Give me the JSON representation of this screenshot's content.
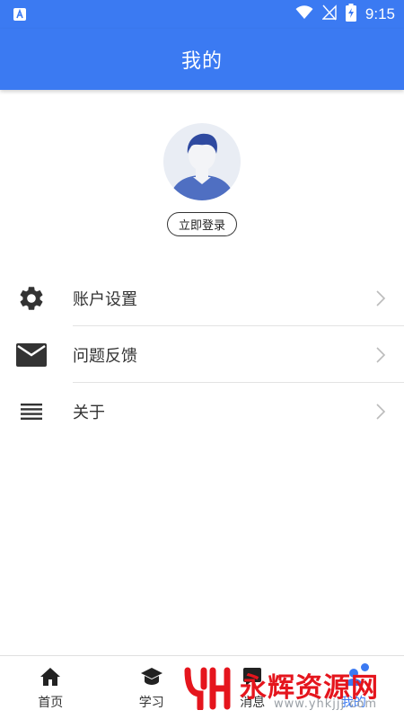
{
  "status_bar": {
    "time": "9:15",
    "left_icon": "a-notification-icon",
    "icons": [
      "wifi-icon",
      "no-signal-icon",
      "battery-charging-icon"
    ]
  },
  "header": {
    "title": "我的"
  },
  "profile": {
    "avatar_icon": "user-avatar-icon",
    "login_label": "立即登录"
  },
  "menu": {
    "items": [
      {
        "label": "账户设置",
        "icon": "gear-icon"
      },
      {
        "label": "问题反馈",
        "icon": "mail-icon"
      },
      {
        "label": "关于",
        "icon": "list-icon"
      }
    ]
  },
  "bottom_nav": {
    "items": [
      {
        "label": "首页",
        "icon": "home-icon"
      },
      {
        "label": "学习",
        "icon": "graduation-cap-icon"
      },
      {
        "label": "消息",
        "icon": "message-icon"
      },
      {
        "label": "我的",
        "icon": "profile-icon"
      }
    ]
  },
  "watermark": {
    "title": "永辉资源网",
    "url": "www.yhkjjj.com"
  },
  "colors": {
    "primary": "#3b7af2",
    "text": "#333333",
    "divider": "#e3e3e3",
    "watermark_red": "#e5151d"
  }
}
